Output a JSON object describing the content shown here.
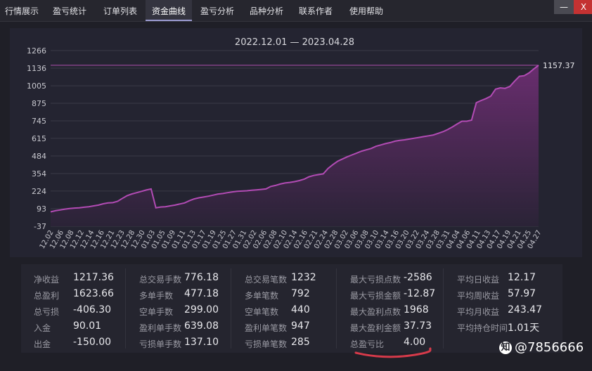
{
  "tabs": [
    {
      "label": "行情展示",
      "active": false
    },
    {
      "label": "盈亏统计",
      "active": false
    },
    {
      "label": "订单列表",
      "active": false
    },
    {
      "label": "资金曲线",
      "active": true
    },
    {
      "label": "盈亏分析",
      "active": false
    },
    {
      "label": "品种分析",
      "active": false
    },
    {
      "label": "联系作者",
      "active": false
    },
    {
      "label": "使用帮助",
      "active": false
    }
  ],
  "window": {
    "minimize_label": "—",
    "close_label": "X"
  },
  "colors": {
    "accent": "#b14fb1",
    "line": "#b24bb4",
    "fill_top": "#6d2e72",
    "fill_bottom": "#2b2337",
    "close": "#c43232"
  },
  "chart_data": {
    "type": "area",
    "title": "2022.12.01 — 2023.04.28",
    "last_value_label": "1157.37",
    "ylim": [
      -37,
      1266
    ],
    "yticks": [
      "1266",
      "1136",
      "1005",
      "875",
      "745",
      "615",
      "484",
      "354",
      "224",
      "93",
      "-37"
    ],
    "xticks": [
      "12.02",
      "12.06",
      "12.08",
      "12.12",
      "12.14",
      "12.16",
      "12.21",
      "12.23",
      "12.28",
      "12.30",
      "01.03",
      "01.05",
      "01.09",
      "01.11",
      "01.13",
      "01.17",
      "01.19",
      "01.25",
      "01.27",
      "01.31",
      "02.02",
      "02.06",
      "02.08",
      "02.10",
      "02.14",
      "02.16",
      "02.21",
      "02.24",
      "02.28",
      "03.02",
      "03.06",
      "03.08",
      "03.10",
      "03.14",
      "03.16",
      "03.20",
      "03.22",
      "03.24",
      "03.28",
      "03.31",
      "04.04",
      "04.06",
      "04.11",
      "04.13",
      "04.17",
      "04.19",
      "04.21",
      "04.25",
      "04.27"
    ],
    "series": [
      {
        "values": [
          70,
          78,
          84,
          90,
          95,
          98,
          100,
          104,
          108,
          114,
          120,
          130,
          136,
          138,
          148,
          170,
          190,
          203,
          212,
          222,
          232,
          240,
          100,
          106,
          108,
          114,
          120,
          128,
          136,
          152,
          166,
          174,
          180,
          186,
          194,
          202,
          206,
          212,
          218,
          222,
          224,
          226,
          230,
          233,
          236,
          240,
          258,
          266,
          276,
          284,
          288,
          294,
          302,
          312,
          330,
          340,
          346,
          352,
          392,
          420,
          445,
          462,
          478,
          492,
          506,
          520,
          530,
          540,
          556,
          566,
          576,
          584,
          594,
          600,
          604,
          610,
          616,
          622,
          628,
          634,
          640,
          652,
          664,
          680,
          700,
          722,
          742,
          742,
          750,
          880,
          896,
          910,
          928,
          980,
          990,
          986,
          1000,
          1040,
          1075,
          1080,
          1100,
          1130,
          1157
        ]
      }
    ],
    "grid": true
  },
  "stats": {
    "col1": [
      {
        "label": "净收益",
        "value": "1217.36"
      },
      {
        "label": "总盈利",
        "value": "1623.66"
      },
      {
        "label": "总亏损",
        "value": "-406.30"
      },
      {
        "label": "入金",
        "value": "90.01"
      },
      {
        "label": "出金",
        "value": "-150.00"
      }
    ],
    "col2": [
      {
        "label": "总交易手数",
        "value": "776.18"
      },
      {
        "label": "多单手数",
        "value": "477.18"
      },
      {
        "label": "空单手数",
        "value": "299.00"
      },
      {
        "label": "盈利单手数",
        "value": "639.08"
      },
      {
        "label": "亏损单手数",
        "value": "137.10"
      }
    ],
    "col3": [
      {
        "label": "总交易笔数",
        "value": "1232"
      },
      {
        "label": "多单笔数",
        "value": "792"
      },
      {
        "label": "空单笔数",
        "value": "440"
      },
      {
        "label": "盈利单笔数",
        "value": "947"
      },
      {
        "label": "亏损单笔数",
        "value": "285"
      }
    ],
    "col4": [
      {
        "label": "最大亏损点数",
        "value": "-2586"
      },
      {
        "label": "最大亏损金额",
        "value": "-12.87"
      },
      {
        "label": "最大盈利点数",
        "value": "1968"
      },
      {
        "label": "最大盈利金额",
        "value": "37.73"
      },
      {
        "label": "总盈亏比",
        "value": "4.00"
      }
    ],
    "col5": [
      {
        "label": "平均日收益",
        "value": "12.17"
      },
      {
        "label": "平均周收益",
        "value": "57.97"
      },
      {
        "label": "平均月收益",
        "value": "243.47"
      },
      {
        "label": "平均持仓时间",
        "value": "1.01天"
      }
    ]
  },
  "watermark": {
    "icon": "知",
    "text": "@7856666"
  }
}
